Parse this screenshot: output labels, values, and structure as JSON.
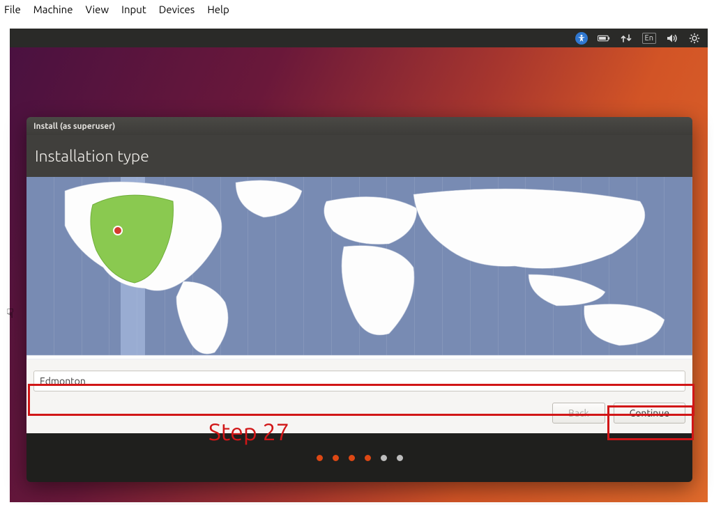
{
  "host_menu": [
    "File",
    "Machine",
    "View",
    "Input",
    "Devices",
    "Help"
  ],
  "guest_panel": {
    "lang_indicator": "En"
  },
  "installer": {
    "title": "Install (as superuser)",
    "heading": "Installation type",
    "timezone_input": "Edmonton",
    "back_label": "Back",
    "continue_label": "Continue"
  },
  "annotations": {
    "step_label": "Step 27"
  },
  "icons": {
    "a11y": "accessibility-icon",
    "battery": "battery-icon",
    "network": "network-updown-icon",
    "sound": "sound-icon",
    "gear": "gear-icon",
    "pointer": "hand-cursor"
  },
  "slideshow_dots": [
    "orange",
    "orange",
    "orange",
    "orange",
    "grey",
    "grey"
  ]
}
